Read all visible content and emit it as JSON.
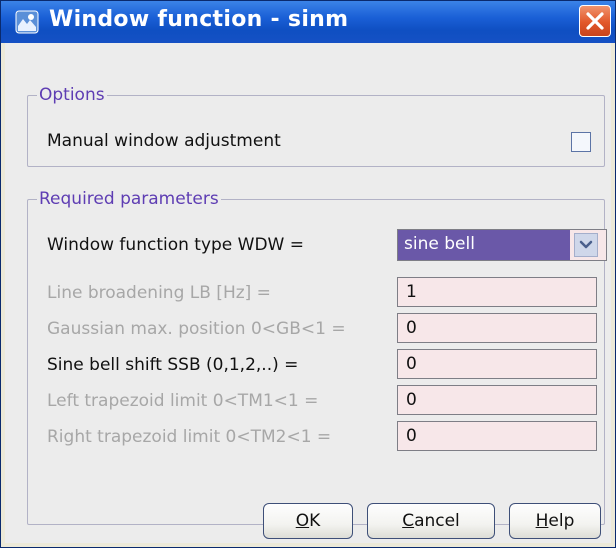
{
  "window": {
    "title": "Window function - sinm",
    "close_glyph": "✕"
  },
  "options": {
    "legend": "Options",
    "manual_label": "Manual window adjustment",
    "manual_checked": false
  },
  "params": {
    "legend": "Required parameters",
    "wdw_label": "Window function type WDW =",
    "wdw_value": "sine bell",
    "rows": [
      {
        "label": "Line broadening LB [Hz] =",
        "value": "1",
        "enabled": false
      },
      {
        "label": "Gaussian max. position 0<GB<1 =",
        "value": "0",
        "enabled": false
      },
      {
        "label": "Sine bell shift SSB (0,1,2,..) =",
        "value": "0",
        "enabled": true
      },
      {
        "label": "Left trapezoid limit 0<TM1<1 =",
        "value": "0",
        "enabled": false
      },
      {
        "label": "Right trapezoid limit 0<TM2<1 =",
        "value": "0",
        "enabled": false
      }
    ]
  },
  "buttons": {
    "ok_mnemonic": "O",
    "ok_rest": "K",
    "cancel_mnemonic": "C",
    "cancel_rest": "ancel",
    "help_mnemonic": "H",
    "help_rest": "elp"
  },
  "colors": {
    "titlebar": "#1a5fd6",
    "legend": "#5e3db3",
    "field_bg": "#f7e7e9",
    "selection": "#6a58a8",
    "disabled_text": "#a7a7a7"
  }
}
